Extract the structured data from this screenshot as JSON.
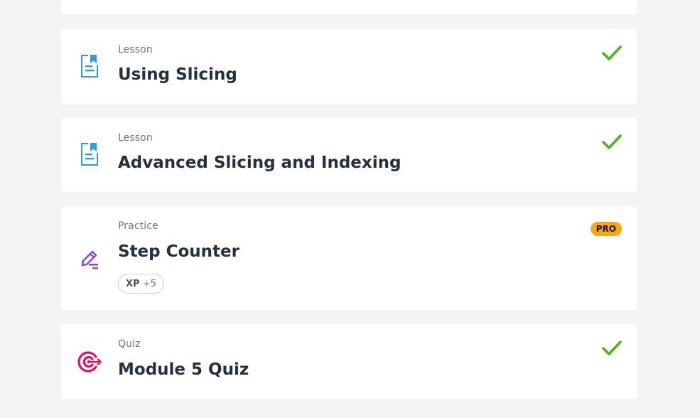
{
  "items": [
    {
      "type": "Lesson",
      "title": "Using Slicing",
      "status": "completed"
    },
    {
      "type": "Lesson",
      "title": "Advanced Slicing and Indexing",
      "status": "completed"
    },
    {
      "type": "Practice",
      "title": "Step Counter",
      "badge": "PRO",
      "xp_label": "XP",
      "xp_value": "+5"
    },
    {
      "type": "Quiz",
      "title": "Module 5 Quiz",
      "status": "completed"
    }
  ],
  "icons": {
    "lesson": "document-bookmark-icon",
    "practice": "pencil-edit-icon",
    "quiz": "target-icon",
    "completed": "checkmark-icon"
  },
  "colors": {
    "background": "#f2f4f6",
    "card": "#ffffff",
    "lesson_icon": "#2b9ee8",
    "practice_icon": "#8a4fd8",
    "quiz_icon": "#e0115f",
    "check": "#4bb31f",
    "pro_badge": "#f9a51b",
    "title_text": "#233040",
    "meta_text": "#6e7782"
  }
}
